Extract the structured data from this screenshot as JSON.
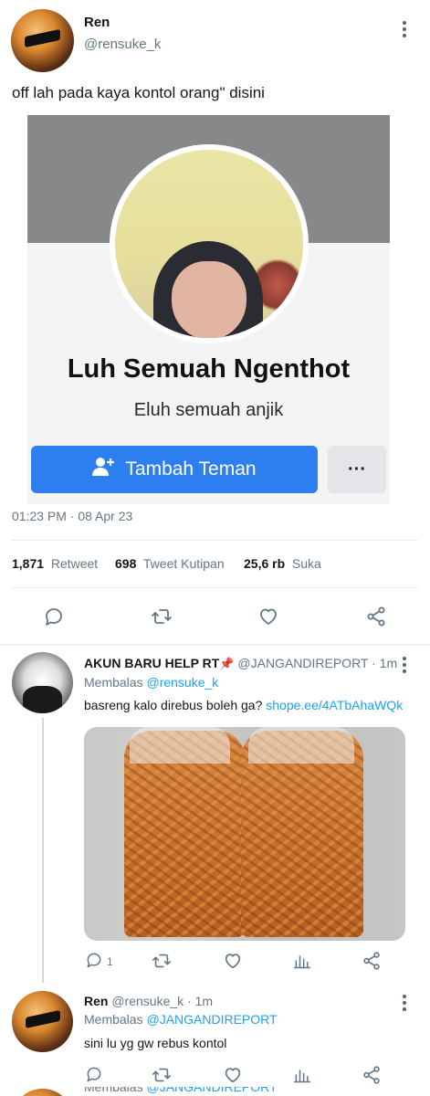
{
  "main_tweet": {
    "name": "Ren",
    "handle": "@rensuke_k",
    "text": "off lah pada kaya kontol orang\" disini",
    "timestamp": "01:23 PM · 08 Apr 23",
    "stats": {
      "retweets_count": "1,871",
      "retweets_label": "Retweet",
      "quotes_count": "698",
      "quotes_label": "Tweet Kutipan",
      "likes_count": "25,6 rb",
      "likes_label": "Suka"
    },
    "actions": [
      "reply-icon",
      "retweet-icon",
      "like-icon",
      "share-icon"
    ]
  },
  "embedded_profile": {
    "name": "Luh Semuah Ngenthot",
    "bio": "Eluh semuah anjik",
    "add_friend_label": "Tambah Teman",
    "more_label": "···"
  },
  "reply1": {
    "name": "AKUN BARU HELP RT",
    "pin_emoji": "📌",
    "handle": "@JANGANDIREPORT",
    "time": "· 1m",
    "replying_prefix": "Membalas",
    "replying_to": "@rensuke_k",
    "text": "basreng kalo direbus boleh ga?",
    "link": "shope.ee/4ATbAhaWQk",
    "reply_count": "1"
  },
  "reply2": {
    "name": "Ren",
    "handle": "@rensuke_k",
    "time": "· 1m",
    "replying_prefix": "Membalas",
    "replying_to": "@JANGANDIREPORT",
    "text": "sini lu yg gw rebus kontol"
  },
  "peek_row": {
    "replying_prefix": "Membalas",
    "replying_to": "@JANGANDIREPORT"
  },
  "colors": {
    "link": "#1da1f2",
    "muted": "#657786",
    "facebook_blue": "#2d7ff0"
  }
}
